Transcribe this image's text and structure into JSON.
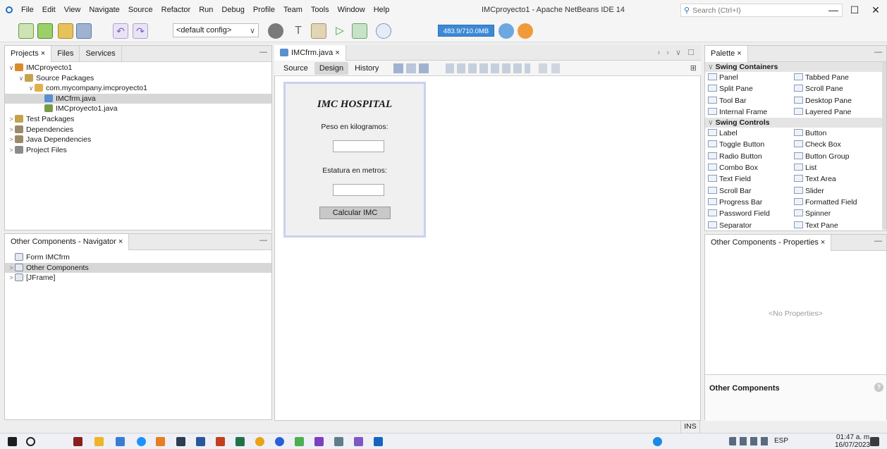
{
  "menubar": {
    "items": [
      "File",
      "Edit",
      "View",
      "Navigate",
      "Source",
      "Refactor",
      "Run",
      "Debug",
      "Profile",
      "Team",
      "Tools",
      "Window",
      "Help"
    ],
    "window_title": "IMCproyecto1 - Apache NetBeans IDE 14",
    "search_placeholder": "Search (Ctrl+I)",
    "min": "—",
    "max": "☐",
    "close": "✕"
  },
  "toolbar": {
    "config": "<default config>",
    "memory": "483.9/710.0MB"
  },
  "projects_panel": {
    "tabs": [
      "Projects ×",
      "Files",
      "Services"
    ],
    "minimize": "—",
    "tree": [
      {
        "label": "IMCproyecto1",
        "indent": 0,
        "toggle": "∨",
        "icon": "project-icon",
        "color": "#d98b2b"
      },
      {
        "label": "Source Packages",
        "indent": 1,
        "toggle": "∨",
        "icon": "source-packages-icon",
        "color": "#c6a24a"
      },
      {
        "label": "com.mycompany.imcproyecto1",
        "indent": 2,
        "toggle": "∨",
        "icon": "package-icon",
        "color": "#e0b04a"
      },
      {
        "label": "IMCfrm.java",
        "indent": 3,
        "toggle": "",
        "icon": "form-file-icon",
        "color": "#5a8fd0",
        "selected": true
      },
      {
        "label": "IMCproyecto1.java",
        "indent": 3,
        "toggle": "",
        "icon": "java-file-icon",
        "color": "#7a9a4a"
      },
      {
        "label": "Test Packages",
        "indent": 0,
        "toggle": ">",
        "icon": "test-packages-icon",
        "color": "#c6a24a"
      },
      {
        "label": "Dependencies",
        "indent": 0,
        "toggle": ">",
        "icon": "dependencies-icon",
        "color": "#9a8a6a"
      },
      {
        "label": "Java Dependencies",
        "indent": 0,
        "toggle": ">",
        "icon": "java-dependencies-icon",
        "color": "#9a8a6a"
      },
      {
        "label": "Project Files",
        "indent": 0,
        "toggle": ">",
        "icon": "project-files-icon",
        "color": "#8a8a8a"
      }
    ]
  },
  "navigator_panel": {
    "tab": "Other Components - Navigator ×",
    "minimize": "—",
    "tree": [
      {
        "label": "Form IMCfrm",
        "toggle": "",
        "icon": "form-icon"
      },
      {
        "label": "Other Components",
        "toggle": ">",
        "icon": "other-components-icon",
        "selected": true
      },
      {
        "label": "[JFrame]",
        "toggle": ">",
        "icon": "jframe-icon"
      }
    ]
  },
  "editor": {
    "tab": "IMCfrm.java ×",
    "modes": [
      "Source",
      "Design",
      "History"
    ],
    "nav_controls": "‹ › ∨ ☐",
    "expand": "⊞"
  },
  "form": {
    "title": "IMC HOSPITAL",
    "label_peso": "Peso en kilogramos:",
    "label_estatura": "Estatura en metros:",
    "button": "Calcular IMC"
  },
  "palette": {
    "tab": "Palette ×",
    "minimize": "—",
    "sections": [
      {
        "header": "Swing Containers",
        "items": [
          "Panel",
          "Tabbed Pane",
          "Split Pane",
          "Scroll Pane",
          "Tool Bar",
          "Desktop Pane",
          "Internal Frame",
          "Layered Pane"
        ]
      },
      {
        "header": "Swing Controls",
        "items": [
          "Label",
          "Button",
          "Toggle Button",
          "Check Box",
          "Radio Button",
          "Button Group",
          "Combo Box",
          "List",
          "Text Field",
          "Text Area",
          "Scroll Bar",
          "Slider",
          "Progress Bar",
          "Formatted Field",
          "Password Field",
          "Spinner",
          "Separator",
          "Text Pane"
        ]
      }
    ]
  },
  "properties_panel": {
    "tab": "Other Components - Properties ×",
    "minimize": "—",
    "empty": "<No Properties>",
    "footer": "Other Components",
    "help": "?"
  },
  "statusbar": {
    "mode": "INS"
  },
  "taskbar": {
    "lang": "ESP",
    "time": "01:47 a. m.",
    "date": "16/07/2023"
  }
}
